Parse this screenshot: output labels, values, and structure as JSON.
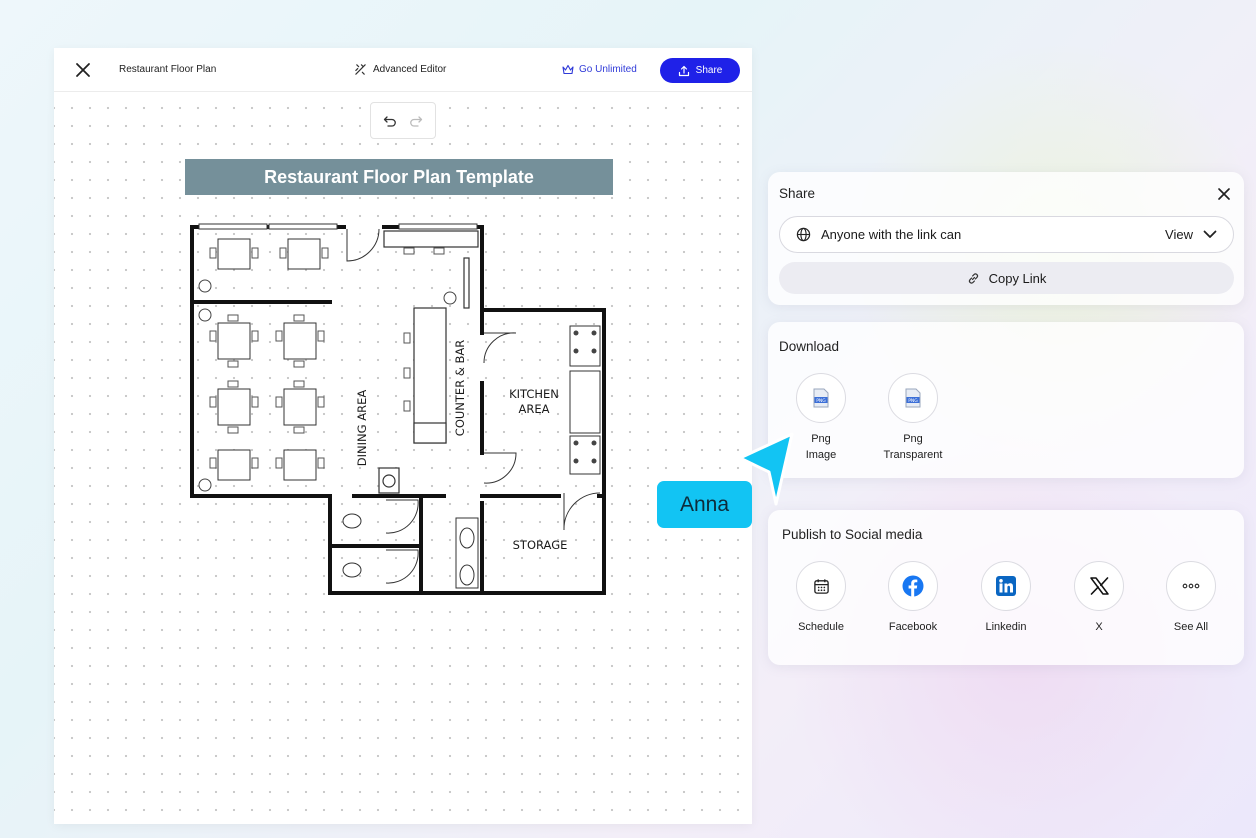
{
  "editor": {
    "doc_title": "Restaurant Floor Plan",
    "advanced_editor": "Advanced Editor",
    "go_unlimited": "Go Unlimited",
    "share": "Share"
  },
  "floor_plan": {
    "title": "Restaurant Floor Plan Template",
    "rooms": {
      "dining": "DINING AREA",
      "counter": "COUNTER & BAR",
      "kitchen_line1": "KITCHEN",
      "kitchen_line2": "AREA",
      "storage": "STORAGE"
    }
  },
  "share_panel": {
    "title": "Share",
    "access_text": "Anyone with the link can",
    "access_value": "View",
    "copy_link": "Copy Link"
  },
  "download_panel": {
    "title": "Download",
    "items": [
      {
        "line1": "Png",
        "line2": "Image",
        "icon": "png-file-icon"
      },
      {
        "line1": "Png",
        "line2": "Transparent",
        "icon": "png-file-icon"
      }
    ]
  },
  "social_panel": {
    "title": "Publish to Social media",
    "items": [
      {
        "label": "Schedule",
        "icon": "calendar-icon"
      },
      {
        "label": "Facebook",
        "icon": "facebook-icon"
      },
      {
        "label": "Linkedin",
        "icon": "linkedin-icon"
      },
      {
        "label": "X",
        "icon": "x-icon"
      },
      {
        "label": "See All",
        "icon": "more-icon"
      }
    ]
  },
  "collaborator": {
    "name": "Anna",
    "color": "#12c4f3"
  },
  "colors": {
    "accent": "#1f21e8",
    "title_bar": "#75909a"
  }
}
